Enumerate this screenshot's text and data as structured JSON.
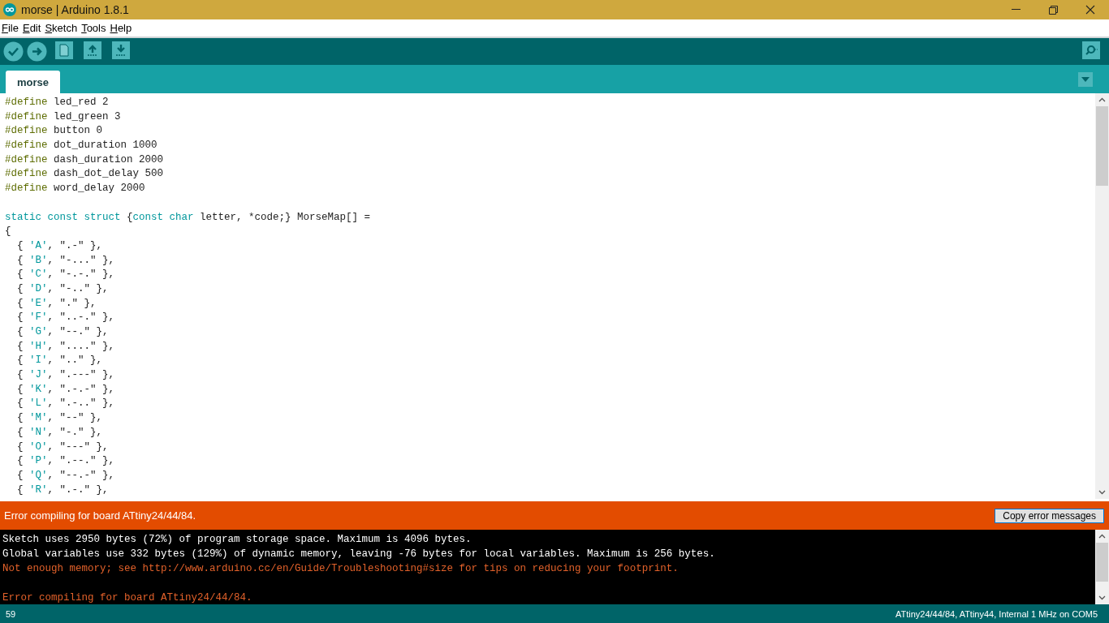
{
  "window": {
    "title": "morse | Arduino 1.8.1"
  },
  "menu": [
    "File",
    "Edit",
    "Sketch",
    "Tools",
    "Help"
  ],
  "tabs": [
    {
      "label": "morse",
      "selected": true
    }
  ],
  "editor": {
    "lines": [
      {
        "segments": [
          {
            "text": "#define",
            "kind": "directive"
          },
          {
            "text": " led_red 2",
            "kind": "plain"
          }
        ]
      },
      {
        "segments": [
          {
            "text": "#define",
            "kind": "directive"
          },
          {
            "text": " led_green 3",
            "kind": "plain"
          }
        ]
      },
      {
        "segments": [
          {
            "text": "#define",
            "kind": "directive"
          },
          {
            "text": " button 0",
            "kind": "plain"
          }
        ]
      },
      {
        "segments": [
          {
            "text": "#define",
            "kind": "directive"
          },
          {
            "text": " dot_duration 1000",
            "kind": "plain"
          }
        ]
      },
      {
        "segments": [
          {
            "text": "#define",
            "kind": "directive"
          },
          {
            "text": " dash_duration 2000",
            "kind": "plain"
          }
        ]
      },
      {
        "segments": [
          {
            "text": "#define",
            "kind": "directive"
          },
          {
            "text": " dash_dot_delay 500",
            "kind": "plain"
          }
        ]
      },
      {
        "segments": [
          {
            "text": "#define",
            "kind": "directive"
          },
          {
            "text": " word_delay 2000",
            "kind": "plain"
          }
        ]
      },
      {
        "gap_before": true,
        "segments": [
          {
            "text": "static const struct",
            "kind": "keyword"
          },
          {
            "text": " {",
            "kind": "plain"
          },
          {
            "text": "const char",
            "kind": "keyword"
          },
          {
            "text": " letter, *code;} MorseMap[] =",
            "kind": "plain"
          }
        ]
      },
      {
        "segments": [
          {
            "text": "{",
            "kind": "plain"
          }
        ]
      },
      {
        "segments": [
          {
            "text": "  { ",
            "kind": "plain"
          },
          {
            "text": "'A'",
            "kind": "char"
          },
          {
            "text": ", \".-\" },",
            "kind": "plain"
          }
        ]
      },
      {
        "segments": [
          {
            "text": "  { ",
            "kind": "plain"
          },
          {
            "text": "'B'",
            "kind": "char"
          },
          {
            "text": ", \"-...\" },",
            "kind": "plain"
          }
        ]
      },
      {
        "segments": [
          {
            "text": "  { ",
            "kind": "plain"
          },
          {
            "text": "'C'",
            "kind": "char"
          },
          {
            "text": ", \"-.-.\" },",
            "kind": "plain"
          }
        ]
      },
      {
        "segments": [
          {
            "text": "  { ",
            "kind": "plain"
          },
          {
            "text": "'D'",
            "kind": "char"
          },
          {
            "text": ", \"-..\" },",
            "kind": "plain"
          }
        ]
      },
      {
        "segments": [
          {
            "text": "  { ",
            "kind": "plain"
          },
          {
            "text": "'E'",
            "kind": "char"
          },
          {
            "text": ", \".\" },",
            "kind": "plain"
          }
        ]
      },
      {
        "segments": [
          {
            "text": "  { ",
            "kind": "plain"
          },
          {
            "text": "'F'",
            "kind": "char"
          },
          {
            "text": ", \"..-.\" },",
            "kind": "plain"
          }
        ]
      },
      {
        "segments": [
          {
            "text": "  { ",
            "kind": "plain"
          },
          {
            "text": "'G'",
            "kind": "char"
          },
          {
            "text": ", \"--.\" },",
            "kind": "plain"
          }
        ]
      },
      {
        "segments": [
          {
            "text": "  { ",
            "kind": "plain"
          },
          {
            "text": "'H'",
            "kind": "char"
          },
          {
            "text": ", \"....\" },",
            "kind": "plain"
          }
        ]
      },
      {
        "segments": [
          {
            "text": "  { ",
            "kind": "plain"
          },
          {
            "text": "'I'",
            "kind": "char"
          },
          {
            "text": ", \"..\" },",
            "kind": "plain"
          }
        ]
      },
      {
        "segments": [
          {
            "text": "  { ",
            "kind": "plain"
          },
          {
            "text": "'J'",
            "kind": "char"
          },
          {
            "text": ", \".---\" },",
            "kind": "plain"
          }
        ]
      },
      {
        "segments": [
          {
            "text": "  { ",
            "kind": "plain"
          },
          {
            "text": "'K'",
            "kind": "char"
          },
          {
            "text": ", \".-.-\" },",
            "kind": "plain"
          }
        ]
      },
      {
        "segments": [
          {
            "text": "  { ",
            "kind": "plain"
          },
          {
            "text": "'L'",
            "kind": "char"
          },
          {
            "text": ", \".-..\" },",
            "kind": "plain"
          }
        ]
      },
      {
        "segments": [
          {
            "text": "  { ",
            "kind": "plain"
          },
          {
            "text": "'M'",
            "kind": "char"
          },
          {
            "text": ", \"--\" },",
            "kind": "plain"
          }
        ]
      },
      {
        "segments": [
          {
            "text": "  { ",
            "kind": "plain"
          },
          {
            "text": "'N'",
            "kind": "char"
          },
          {
            "text": ", \"-.\" },",
            "kind": "plain"
          }
        ]
      },
      {
        "segments": [
          {
            "text": "  { ",
            "kind": "plain"
          },
          {
            "text": "'O'",
            "kind": "char"
          },
          {
            "text": ", \"---\" },",
            "kind": "plain"
          }
        ]
      },
      {
        "segments": [
          {
            "text": "  { ",
            "kind": "plain"
          },
          {
            "text": "'P'",
            "kind": "char"
          },
          {
            "text": ", \".--.\" },",
            "kind": "plain"
          }
        ]
      },
      {
        "segments": [
          {
            "text": "  { ",
            "kind": "plain"
          },
          {
            "text": "'Q'",
            "kind": "char"
          },
          {
            "text": ", \"--.-\" },",
            "kind": "plain"
          }
        ]
      },
      {
        "segments": [
          {
            "text": "  { ",
            "kind": "plain"
          },
          {
            "text": "'R'",
            "kind": "char"
          },
          {
            "text": ", \".-.\" },",
            "kind": "plain"
          }
        ]
      }
    ]
  },
  "error_bar": {
    "message": "Error compiling for board ATtiny24/44/84.",
    "button": "Copy error messages"
  },
  "console": [
    {
      "kind": "normal",
      "text": "Sketch uses 2950 bytes (72%) of program storage space. Maximum is 4096 bytes."
    },
    {
      "kind": "normal",
      "text": "Global variables use 332 bytes (129%) of dynamic memory, leaving -76 bytes for local variables. Maximum is 256 bytes."
    },
    {
      "kind": "error",
      "text": "Not enough memory; see http://www.arduino.cc/en/Guide/Troubleshooting#size for tips on reducing your footprint."
    },
    {
      "kind": "error",
      "gap_before": true,
      "text": "Error compiling for board ATtiny24/44/84."
    }
  ],
  "status_bar": {
    "line": "59",
    "board": "ATtiny24/44/84, ATtiny44, Internal 1 MHz on COM5"
  }
}
